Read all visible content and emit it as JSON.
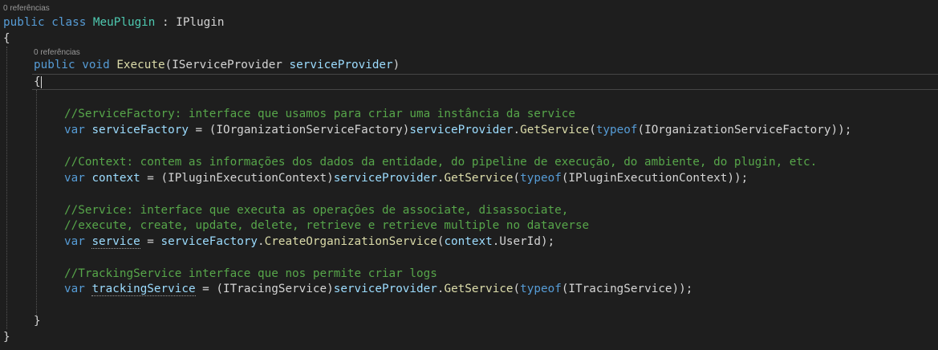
{
  "codelens": {
    "class_refs": "0 referências",
    "method_refs": "0 referências"
  },
  "code": {
    "l1": {
      "kw1": "public",
      "kw2": "class",
      "cls": "MeuPlugin",
      "sep": " : ",
      "iface": "IPlugin"
    },
    "l2": {
      "brace": "{"
    },
    "l3": {
      "kw1": "public",
      "kw2": "void",
      "name": "Execute",
      "p1": "(",
      "ptype": "IServiceProvider",
      "pname": "serviceProvider",
      "p2": ")"
    },
    "l4": {
      "brace": "{"
    },
    "c1": "//ServiceFactory: interface que usamos para criar uma instância da service",
    "l6": {
      "kw": "var",
      "v": "serviceFactory",
      "eq": " = (",
      "t": "IOrganizationServiceFactory",
      "cp": ")",
      "obj": "serviceProvider",
      "dot": ".",
      "m": "GetService",
      "o": "(",
      "typeof": "typeof",
      "o2": "(",
      "t2": "IOrganizationServiceFactory",
      "end": "));"
    },
    "c2": "//Context: contem as informações dos dados da entidade, do pipeline de execução, do ambiente, do plugin, etc.",
    "l8": {
      "kw": "var",
      "v": "context",
      "eq": " = (",
      "t": "IPluginExecutionContext",
      "cp": ")",
      "obj": "serviceProvider",
      "dot": ".",
      "m": "GetService",
      "o": "(",
      "typeof": "typeof",
      "o2": "(",
      "t2": "IPluginExecutionContext",
      "end": "));"
    },
    "c3a": "//Service: interface que executa as operações de associate, disassociate,",
    "c3b": "//execute, create, update, delete, retrieve e retrieve multiple no dataverse",
    "l11": {
      "kw": "var",
      "v": "service",
      "eq": " = ",
      "obj": "serviceFactory",
      "dot": ".",
      "m": "CreateOrganizationService",
      "o": "(",
      "arg": "context",
      "dot2": ".",
      "prop": "UserId",
      "end": ");"
    },
    "c4": "//TrackingService interface que nos permite criar logs",
    "l13": {
      "kw": "var",
      "v": "trackingService",
      "eq": " = (",
      "t": "ITracingService",
      "cp": ")",
      "obj": "serviceProvider",
      "dot": ".",
      "m": "GetService",
      "o": "(",
      "typeof": "typeof",
      "o2": "(",
      "t2": "ITracingService",
      "end": "));"
    },
    "l14": {
      "brace": "}"
    },
    "l15": {
      "brace": "}"
    }
  }
}
